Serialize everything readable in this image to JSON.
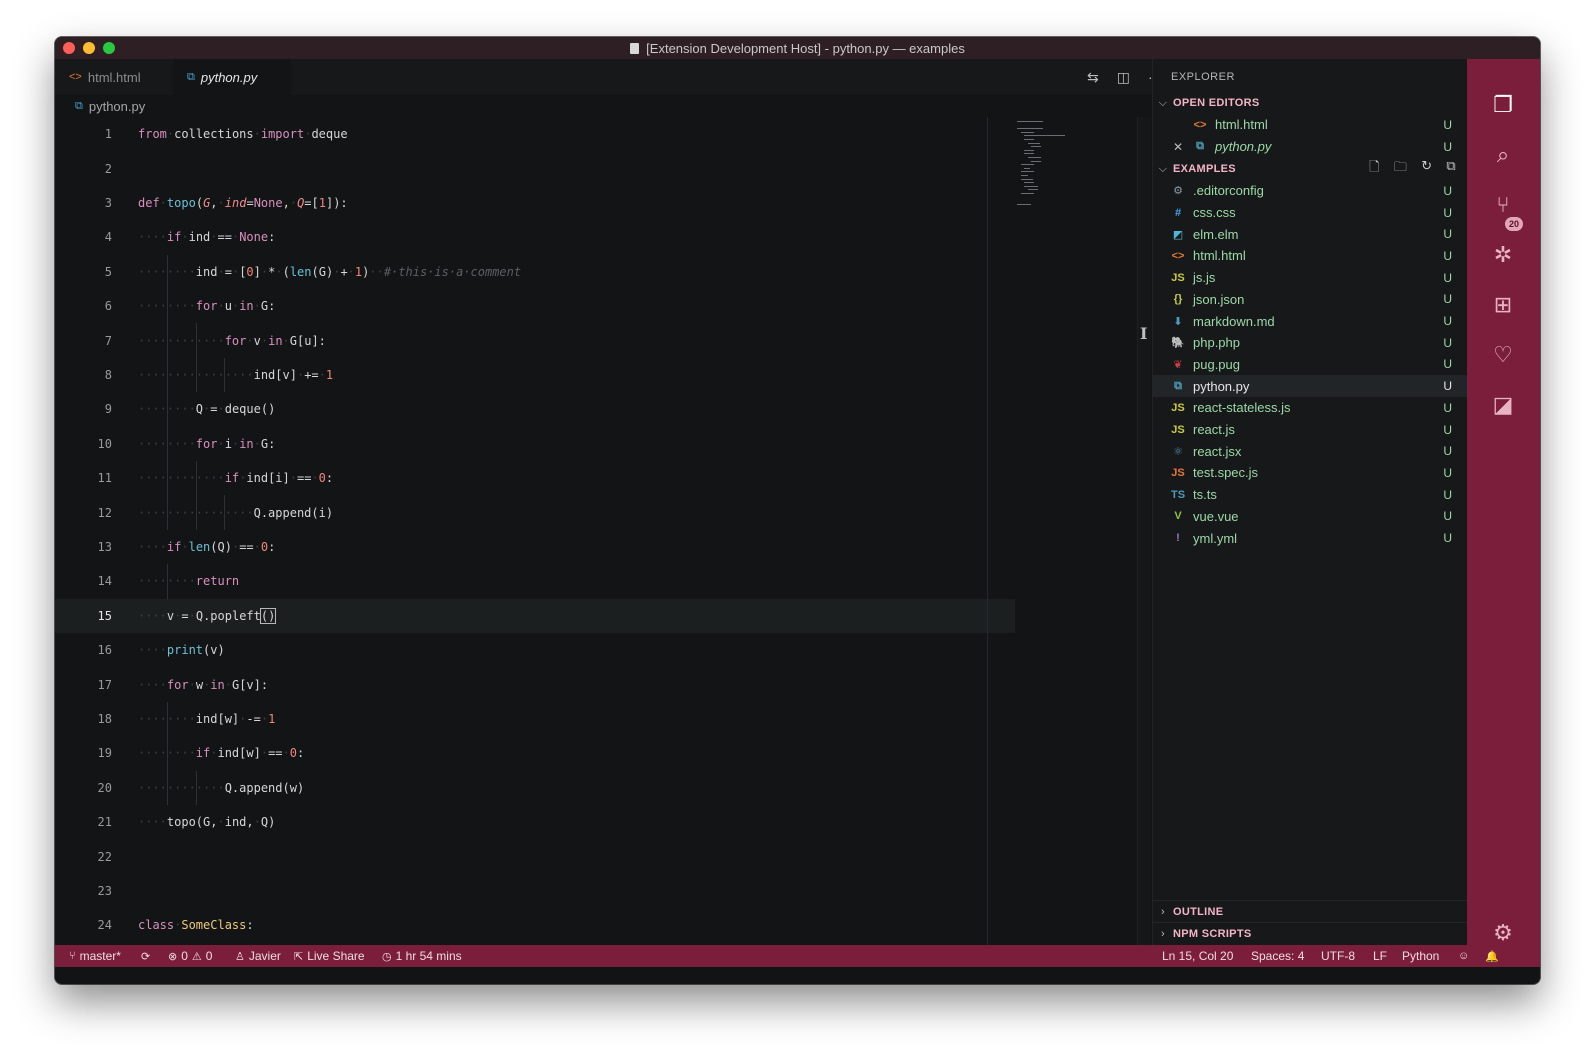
{
  "window": {
    "title": "[Extension Development Host] - python.py — examples"
  },
  "tabs": [
    {
      "label": "html.html",
      "icon": "html-file-icon",
      "active": false
    },
    {
      "label": "python.py",
      "icon": "python-file-icon",
      "active": true
    }
  ],
  "breadcrumb": {
    "file": "python.py"
  },
  "editor": {
    "current_line": 15,
    "lines": [
      "from collections import deque",
      "",
      "def topo(G, ind=None, Q=[1]):",
      "    if ind == None:",
      "        ind = [0] * (len(G) + 1)  # this is a comment",
      "        for u in G:",
      "            for v in G[u]:",
      "                ind[v] += 1",
      "        Q = deque()",
      "        for i in G:",
      "            if ind[i] == 0:",
      "                Q.append(i)",
      "    if len(Q) == 0:",
      "        return",
      "    v = Q.popleft()",
      "    print(v)",
      "    for w in G[v]:",
      "        ind[w] -= 1",
      "        if ind[w] == 0:",
      "            Q.append(w)",
      "    topo(G, ind, Q)",
      "",
      "",
      "class SomeClass:"
    ]
  },
  "explorer": {
    "title": "EXPLORER",
    "open_editors": {
      "label": "OPEN EDITORS",
      "items": [
        {
          "name": "html.html",
          "status": "U",
          "icon": "html-file-icon"
        },
        {
          "name": "python.py",
          "status": "U",
          "icon": "python-file-icon"
        }
      ]
    },
    "folder": {
      "label": "EXAMPLES",
      "files": [
        {
          "name": ".editorconfig",
          "status": "U",
          "icon": "gear-file-icon",
          "glyph": "⚙",
          "color": "#8b9aa6"
        },
        {
          "name": "css.css",
          "status": "U",
          "icon": "css-file-icon",
          "glyph": "#",
          "color": "#42a5f5"
        },
        {
          "name": "elm.elm",
          "status": "U",
          "icon": "elm-file-icon",
          "glyph": "◩",
          "color": "#4fb4d8"
        },
        {
          "name": "html.html",
          "status": "U",
          "icon": "html-file-icon",
          "glyph": "<>",
          "color": "#e37933"
        },
        {
          "name": "js.js",
          "status": "U",
          "icon": "js-file-icon",
          "glyph": "JS",
          "color": "#cbcb41"
        },
        {
          "name": "json.json",
          "status": "U",
          "icon": "json-file-icon",
          "glyph": "{}",
          "color": "#cbcb41"
        },
        {
          "name": "markdown.md",
          "status": "U",
          "icon": "markdown-file-icon",
          "glyph": "⬇",
          "color": "#519aba"
        },
        {
          "name": "php.php",
          "status": "U",
          "icon": "php-file-icon",
          "glyph": "🐘",
          "color": "#a074c4"
        },
        {
          "name": "pug.pug",
          "status": "U",
          "icon": "pug-file-icon",
          "glyph": "❦",
          "color": "#cc3e44"
        },
        {
          "name": "python.py",
          "status": "U",
          "icon": "python-file-icon",
          "glyph": "⧉",
          "color": "#519aba",
          "selected": true
        },
        {
          "name": "react-stateless.js",
          "status": "U",
          "icon": "js-file-icon",
          "glyph": "JS",
          "color": "#cbcb41"
        },
        {
          "name": "react.js",
          "status": "U",
          "icon": "js-file-icon",
          "glyph": "JS",
          "color": "#cbcb41"
        },
        {
          "name": "react.jsx",
          "status": "U",
          "icon": "react-file-icon",
          "glyph": "⚛",
          "color": "#519aba"
        },
        {
          "name": "test.spec.js",
          "status": "U",
          "icon": "test-js-file-icon",
          "glyph": "JS",
          "color": "#e37933"
        },
        {
          "name": "ts.ts",
          "status": "U",
          "icon": "ts-file-icon",
          "glyph": "TS",
          "color": "#519aba"
        },
        {
          "name": "vue.vue",
          "status": "U",
          "icon": "vue-file-icon",
          "glyph": "V",
          "color": "#8dc149"
        },
        {
          "name": "yml.yml",
          "status": "U",
          "icon": "yaml-file-icon",
          "glyph": "!",
          "color": "#a074c4"
        }
      ]
    },
    "outline": {
      "label": "OUTLINE"
    },
    "npm_scripts": {
      "label": "NPM SCRIPTS"
    }
  },
  "activity_bar": {
    "items": [
      "files-icon",
      "search-icon",
      "source-control-icon",
      "debug-icon",
      "extensions-icon",
      "live-share-icon",
      "remote-icon"
    ],
    "source_control_badge": "20"
  },
  "statusbar": {
    "branch": "master*",
    "errors": "0",
    "warnings": "0",
    "user": "Javier",
    "live_share": "Live Share",
    "time": "1 hr 54 mins",
    "cursor": "Ln 15, Col 20",
    "spaces": "Spaces: 4",
    "encoding": "UTF-8",
    "eol": "LF",
    "language": "Python"
  },
  "colors": {
    "accent": "#7a1e3c",
    "git_untracked": "#9dd8a8",
    "section_header": "#f5b5c6"
  }
}
